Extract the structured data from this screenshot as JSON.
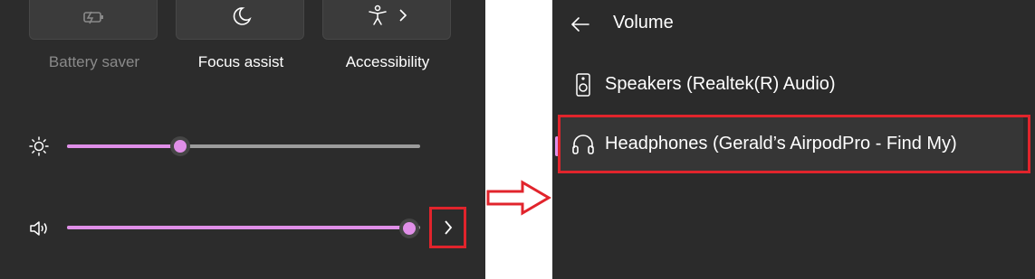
{
  "quick_settings": {
    "tiles": [
      {
        "label": "Battery saver",
        "icon": "battery-saver-icon",
        "state": "disabled"
      },
      {
        "label": "Focus assist",
        "icon": "moon-icon",
        "state": "off"
      },
      {
        "label": "Accessibility",
        "icon": "accessibility-icon",
        "state": "off"
      }
    ],
    "brightness": {
      "icon": "sun-icon",
      "value": 0.32
    },
    "volume": {
      "icon": "speaker-volume-icon",
      "value": 0.97,
      "more_icon": "chevron-right-icon"
    }
  },
  "volume_panel": {
    "back_icon": "arrow-left-icon",
    "title": "Volume",
    "devices": [
      {
        "label": "Speakers (Realtek(R) Audio)",
        "icon": "speaker-device-icon",
        "selected": false
      },
      {
        "label": "Headphones (Gerald’s AirpodPro - Find My)",
        "icon": "headphones-icon",
        "selected": true
      }
    ]
  },
  "colors": {
    "accent": "#e08fe8",
    "highlight": "#e1242c",
    "panel_bg": "#2c2c2c",
    "arrow": "#e1242c"
  }
}
